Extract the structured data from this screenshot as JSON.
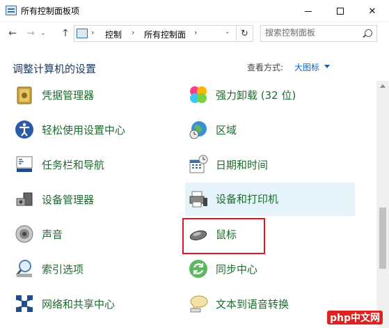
{
  "window": {
    "title": "所有控制面板项",
    "minimize_symbol": "",
    "close_symbol": "✕"
  },
  "nav": {
    "back_symbol": "←",
    "forward_symbol": "→",
    "recent_symbol": "⌄",
    "up_symbol": "↑",
    "breadcrumb": [
      "控制",
      "所有控制面"
    ],
    "separator": "›",
    "dropdown_symbol": "⌄",
    "refresh_symbol": "↻",
    "search_placeholder": "搜索控制面板"
  },
  "header": {
    "title": "调整计算机的设置",
    "view_by_label": "查看方式:",
    "view_by_value": "大图标"
  },
  "items": [
    {
      "id": "credential-manager",
      "label": "凭据管理器",
      "icon": "vault-icon"
    },
    {
      "id": "uninstaller",
      "label": "强力卸载 (32 位)",
      "icon": "colorful-clover-icon"
    },
    {
      "id": "ease-of-access",
      "label": "轻松使用设置中心",
      "icon": "ease-of-access-icon"
    },
    {
      "id": "region",
      "label": "区域",
      "icon": "globe-clock-icon"
    },
    {
      "id": "taskbar",
      "label": "任务栏和导航",
      "icon": "taskbar-icon"
    },
    {
      "id": "date-time",
      "label": "日期和时间",
      "icon": "calendar-clock-icon"
    },
    {
      "id": "device-manager",
      "label": "设备管理器",
      "icon": "device-manager-icon"
    },
    {
      "id": "devices-printers",
      "label": "设备和打印机",
      "icon": "printer-icon"
    },
    {
      "id": "sound",
      "label": "声音",
      "icon": "speaker-icon"
    },
    {
      "id": "mouse",
      "label": "鼠标",
      "icon": "mouse-icon"
    },
    {
      "id": "indexing",
      "label": "索引选项",
      "icon": "magnifier-icon"
    },
    {
      "id": "sync-center",
      "label": "同步中心",
      "icon": "sync-icon"
    },
    {
      "id": "network-sharing",
      "label": "网络和共享中心",
      "icon": "network-icon"
    },
    {
      "id": "text-to-speech",
      "label": "文本到语音转换",
      "icon": "speech-bubble-icon"
    }
  ],
  "colors": {
    "link_green": "#1f6a2f",
    "heading_blue": "#1e395b",
    "accent_blue": "#0066cc",
    "highlight_red": "#e81123",
    "hover_bg": "#e5f3fb"
  },
  "watermark": "php中文网"
}
